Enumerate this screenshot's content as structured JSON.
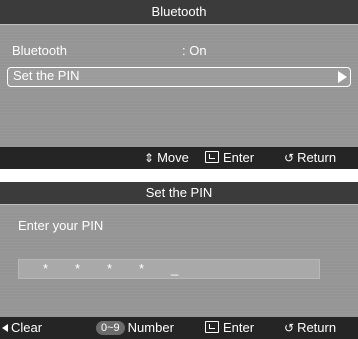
{
  "bluetooth_menu": {
    "title": "Bluetooth",
    "rows": [
      {
        "label": "Bluetooth",
        "value": ": On"
      },
      {
        "label": "Set the PIN"
      }
    ],
    "footer": {
      "move_icon": "⇕",
      "move": "Move",
      "enter": "Enter",
      "return_icon": "↺",
      "return": "Return"
    }
  },
  "pin_dialog": {
    "title": "Set the PIN",
    "prompt": "Enter your PIN",
    "pin_chars": [
      "*",
      "*",
      "*",
      "*",
      "_"
    ],
    "footer": {
      "clear": "Clear",
      "number_key": "0~9",
      "number": "Number",
      "enter": "Enter",
      "return_icon": "↺",
      "return": "Return"
    }
  },
  "icons": {
    "move": "up-down-arrow-icon",
    "enter": "enter-icon",
    "return": "return-icon",
    "clear": "left-arrow-icon",
    "submenu": "right-arrow-icon"
  }
}
